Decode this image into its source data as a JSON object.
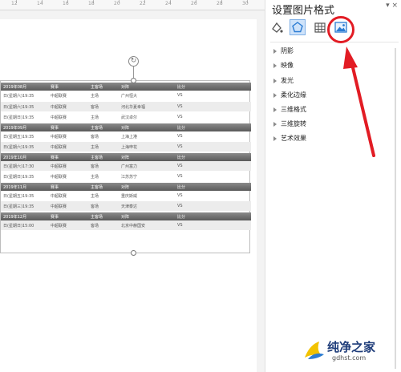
{
  "ruler": {
    "numbers": [
      "12",
      "14",
      "16",
      "18",
      "20",
      "22",
      "24",
      "26",
      "28",
      "30"
    ]
  },
  "table": {
    "rows": [
      {
        "kind": "month",
        "date": "2019年08月",
        "league": "赛事",
        "host": "主客场",
        "opponent": "对阵",
        "score": "比分"
      },
      {
        "kind": "data",
        "date": "日(星期六)19:35",
        "league": "中超联赛",
        "host": "主场",
        "opponent": "广州恒大",
        "score": "VS"
      },
      {
        "kind": "data",
        "date": "日(星期六)19:35",
        "league": "中超联赛",
        "host": "客场",
        "opponent": "河北华夏幸福",
        "score": "VS"
      },
      {
        "kind": "data",
        "date": "日(星期日)19:35",
        "league": "中超联赛",
        "host": "主场",
        "opponent": "武汉卓尔",
        "score": "VS"
      },
      {
        "kind": "month",
        "date": "2019年09月",
        "league": "赛事",
        "host": "主客场",
        "opponent": "对阵",
        "score": "比分"
      },
      {
        "kind": "data",
        "date": "日(星期五)19:35",
        "league": "中超联赛",
        "host": "客场",
        "opponent": "上海上港",
        "score": "VS"
      },
      {
        "kind": "data",
        "date": "日(星期六)19:35",
        "league": "中超联赛",
        "host": "主场",
        "opponent": "上海申花",
        "score": "VS"
      },
      {
        "kind": "month",
        "date": "2019年10月",
        "league": "赛事",
        "host": "主客场",
        "opponent": "对阵",
        "score": "比分"
      },
      {
        "kind": "data",
        "date": "日(星期六)17:30",
        "league": "中超联赛",
        "host": "客场",
        "opponent": "广州富力",
        "score": "VS"
      },
      {
        "kind": "data",
        "date": "日(星期日)19:35",
        "league": "中超联赛",
        "host": "主场",
        "opponent": "江苏苏宁",
        "score": "VS"
      },
      {
        "kind": "month",
        "date": "2019年11月",
        "league": "赛事",
        "host": "主客场",
        "opponent": "对阵",
        "score": "比分"
      },
      {
        "kind": "data",
        "date": "日(星期五)19:35",
        "league": "中超联赛",
        "host": "主场",
        "opponent": "重庆斯威",
        "score": "VS"
      },
      {
        "kind": "data",
        "date": "日(星期三)19:35",
        "league": "中超联赛",
        "host": "客场",
        "opponent": "天津泰达",
        "score": "VS"
      },
      {
        "kind": "month",
        "date": "2019年12月",
        "league": "赛事",
        "host": "主客场",
        "opponent": "对阵",
        "score": "比分"
      },
      {
        "kind": "data",
        "date": "日(星期日)15:00",
        "league": "中超联赛",
        "host": "客场",
        "opponent": "北京中赫国安",
        "score": "VS"
      }
    ]
  },
  "panel": {
    "title": "设置图片格式",
    "controls": "▾ ×",
    "tabs": [
      {
        "name": "fill-line-icon",
        "glyph": "◇"
      },
      {
        "name": "effects-icon",
        "glyph": "⬠"
      },
      {
        "name": "size-properties-icon",
        "glyph": "▦"
      },
      {
        "name": "picture-icon",
        "glyph": "▣"
      }
    ],
    "sections": [
      "阴影",
      "映像",
      "发光",
      "柔化边缘",
      "三维格式",
      "三维旋转",
      "艺术效果"
    ]
  },
  "logo": {
    "text": "纯净之家",
    "url": "gdhst.com"
  },
  "colors": {
    "annotation": "#e21c24",
    "accent": "#2b7cd3"
  }
}
